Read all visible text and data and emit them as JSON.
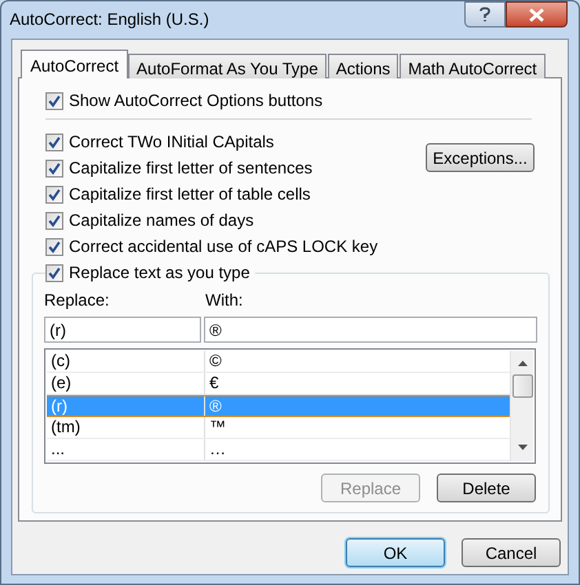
{
  "window": {
    "title": "AutoCorrect: English (U.S.)"
  },
  "tabs": [
    {
      "label": "AutoCorrect",
      "selected": true
    },
    {
      "label": "AutoFormat As You Type",
      "selected": false
    },
    {
      "label": "Actions",
      "selected": false
    },
    {
      "label": "Math AutoCorrect",
      "selected": false
    }
  ],
  "show_options": {
    "label": "Show AutoCorrect Options buttons",
    "checked": true
  },
  "options": [
    {
      "label": "Correct TWo INitial CApitals",
      "checked": true
    },
    {
      "label": "Capitalize first letter of sentences",
      "checked": true
    },
    {
      "label": "Capitalize first letter of table cells",
      "checked": true
    },
    {
      "label": "Capitalize names of days",
      "checked": true
    },
    {
      "label": "Correct accidental use of cAPS LOCK key",
      "checked": true
    }
  ],
  "exceptions_button": {
    "label": "Exceptions..."
  },
  "replace_group": {
    "label": "Replace text as you type",
    "checked": true,
    "replace_label": "Replace:",
    "with_label": "With:",
    "replace_value": "(r)",
    "with_value": "®",
    "rows": [
      {
        "replace": "(c)",
        "with": "©",
        "selected": false
      },
      {
        "replace": "(e)",
        "with": "€",
        "selected": false
      },
      {
        "replace": "(r)",
        "with": "®",
        "selected": true
      },
      {
        "replace": "(tm)",
        "with": "™",
        "selected": false
      },
      {
        "replace": "...",
        "with": "…",
        "selected": false
      }
    ],
    "buttons": [
      {
        "label": "Replace",
        "disabled": true
      },
      {
        "label": "Delete",
        "disabled": false
      }
    ]
  },
  "footer_buttons": [
    {
      "label": "OK",
      "default": true
    },
    {
      "label": "Cancel",
      "default": false
    }
  ]
}
